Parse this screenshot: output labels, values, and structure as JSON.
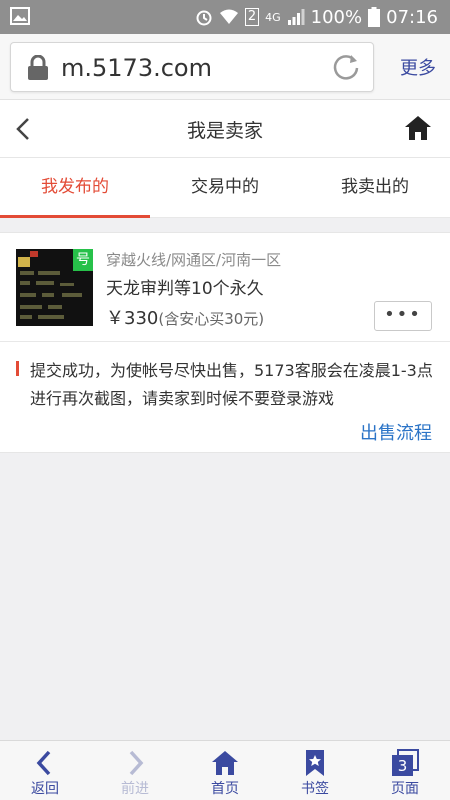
{
  "status_bar": {
    "network": "4G",
    "sim": "2",
    "battery": "100%",
    "time": "07:16"
  },
  "browser": {
    "url": "m.5173.com",
    "more_label": "更多"
  },
  "header": {
    "title": "我是卖家"
  },
  "tabs": [
    {
      "label": "我发布的",
      "active": true
    },
    {
      "label": "交易中的",
      "active": false
    },
    {
      "label": "我卖出的",
      "active": false
    }
  ],
  "listing": {
    "thumb_tag": "号",
    "category": "穿越火线/网通区/河南一区",
    "name": "天龙审判等10个永久",
    "price": "￥330",
    "price_note": "(含安心买30元)",
    "more_button": "•••",
    "notice": "提交成功，为使帐号尽快出售，5173客服会在凌晨1-3点进行再次截图，请卖家到时候不要登录游戏",
    "flow_link": "出售流程"
  },
  "bottom_nav": [
    {
      "label": "返回",
      "icon": "back-arrow-icon",
      "enabled": true
    },
    {
      "label": "前进",
      "icon": "forward-arrow-icon",
      "enabled": false
    },
    {
      "label": "首页",
      "icon": "home-icon",
      "enabled": true
    },
    {
      "label": "书签",
      "icon": "bookmark-icon",
      "enabled": true
    },
    {
      "label": "页面",
      "icon": "pages-icon",
      "enabled": true,
      "badge": "3"
    }
  ],
  "colors": {
    "accent": "#e34b36",
    "link": "#2b74c7",
    "nav": "#3b4aa0"
  }
}
